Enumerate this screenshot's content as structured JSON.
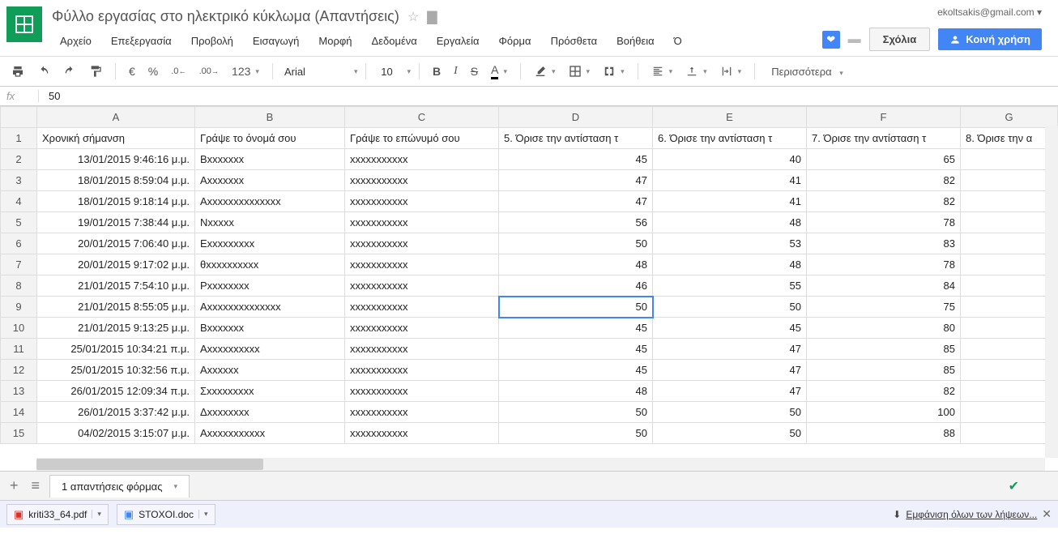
{
  "user_email": "ekoltsakis@gmail.com",
  "doc_title": "Φύλλο εργασίας στο ηλεκτρικό κύκλωμα (Απαντήσεις)",
  "menu": [
    "Αρχείο",
    "Επεξεργασία",
    "Προβολή",
    "Εισαγωγή",
    "Μορφή",
    "Δεδομένα",
    "Εργαλεία",
    "Φόρμα",
    "Πρόσθετα",
    "Βοήθεια",
    "Ό"
  ],
  "buttons": {
    "comments": "Σχόλια",
    "share": "Κοινή χρήση"
  },
  "toolbar": {
    "currency": "€",
    "percent": "%",
    "dec_dec": ".0",
    "dec_inc": ".00",
    "num_fmt": "123",
    "font": "Arial",
    "size": "10",
    "more": "Περισσότερα"
  },
  "formula": {
    "label": "fx",
    "value": "50"
  },
  "columns_letters": [
    "A",
    "B",
    "C",
    "D",
    "E",
    "F",
    "G"
  ],
  "headers": [
    "Χρονική σήμανση",
    "Γράψε το όνομά σου",
    "Γράψε το επώνυμό σου",
    "5. Όρισε την αντίσταση τ",
    "6. Όρισε την αντίσταση τ",
    "7. Όρισε την αντίσταση τ",
    "8. Όρισε την α"
  ],
  "rows": [
    {
      "n": 2,
      "a": "13/01/2015 9:46:16 μ.μ.",
      "b": "Βxxxxxxx",
      "c": "xxxxxxxxxxx",
      "d": "45",
      "e": "40",
      "f": "65",
      "g": ""
    },
    {
      "n": 3,
      "a": "18/01/2015 8:59:04 μ.μ.",
      "b": "Αxxxxxxx",
      "c": "xxxxxxxxxxx",
      "d": "47",
      "e": "41",
      "f": "82",
      "g": ""
    },
    {
      "n": 4,
      "a": "18/01/2015 9:18:14 μ.μ.",
      "b": "Αxxxxxxxxxxxxxx",
      "c": "xxxxxxxxxxx",
      "d": "47",
      "e": "41",
      "f": "82",
      "g": ""
    },
    {
      "n": 5,
      "a": "19/01/2015 7:38:44 μ.μ.",
      "b": "Νxxxxx",
      "c": "xxxxxxxxxxx",
      "d": "56",
      "e": "48",
      "f": "78",
      "g": ""
    },
    {
      "n": 6,
      "a": "20/01/2015 7:06:40 μ.μ.",
      "b": "Εxxxxxxxxx",
      "c": "xxxxxxxxxxx",
      "d": "50",
      "e": "53",
      "f": "83",
      "g": ""
    },
    {
      "n": 7,
      "a": "20/01/2015 9:17:02 μ.μ.",
      "b": "θxxxxxxxxxx",
      "c": "xxxxxxxxxxx",
      "d": "48",
      "e": "48",
      "f": "78",
      "g": ""
    },
    {
      "n": 8,
      "a": "21/01/2015 7:54:10 μ.μ.",
      "b": "Ρxxxxxxxx",
      "c": "xxxxxxxxxxx",
      "d": "46",
      "e": "55",
      "f": "84",
      "g": ""
    },
    {
      "n": 9,
      "a": "21/01/2015 8:55:05 μ.μ.",
      "b": "Αxxxxxxxxxxxxxx",
      "c": "xxxxxxxxxxx",
      "d": "50",
      "e": "50",
      "f": "75",
      "g": ""
    },
    {
      "n": 10,
      "a": "21/01/2015 9:13:25 μ.μ.",
      "b": "Βxxxxxxx",
      "c": "xxxxxxxxxxx",
      "d": "45",
      "e": "45",
      "f": "80",
      "g": ""
    },
    {
      "n": 11,
      "a": "25/01/2015 10:34:21 π.μ.",
      "b": "Αxxxxxxxxxx",
      "c": "xxxxxxxxxxx",
      "d": "45",
      "e": "47",
      "f": "85",
      "g": ""
    },
    {
      "n": 12,
      "a": "25/01/2015 10:32:56 π.μ.",
      "b": "Αxxxxxx",
      "c": "xxxxxxxxxxx",
      "d": "45",
      "e": "47",
      "f": "85",
      "g": ""
    },
    {
      "n": 13,
      "a": "26/01/2015 12:09:34 π.μ.",
      "b": "Σxxxxxxxxx",
      "c": "xxxxxxxxxxx",
      "d": "48",
      "e": "47",
      "f": "82",
      "g": ""
    },
    {
      "n": 14,
      "a": "26/01/2015 3:37:42 μ.μ.",
      "b": "Δxxxxxxxx",
      "c": "xxxxxxxxxxx",
      "d": "50",
      "e": "50",
      "f": "100",
      "g": ""
    },
    {
      "n": 15,
      "a": "04/02/2015 3:15:07 μ.μ.",
      "b": "Αxxxxxxxxxxx",
      "c": "xxxxxxxxxxx",
      "d": "50",
      "e": "50",
      "f": "88",
      "g": ""
    }
  ],
  "selected": {
    "row_index": 7,
    "cell": "D9"
  },
  "sheet_tab": "1 απαντήσεις φόρμας",
  "downloads": {
    "file1": "kriti33_64.pdf",
    "file2": "STOXOI.doc",
    "show_all": "Εμφάνιση όλων των λήψεων..."
  }
}
